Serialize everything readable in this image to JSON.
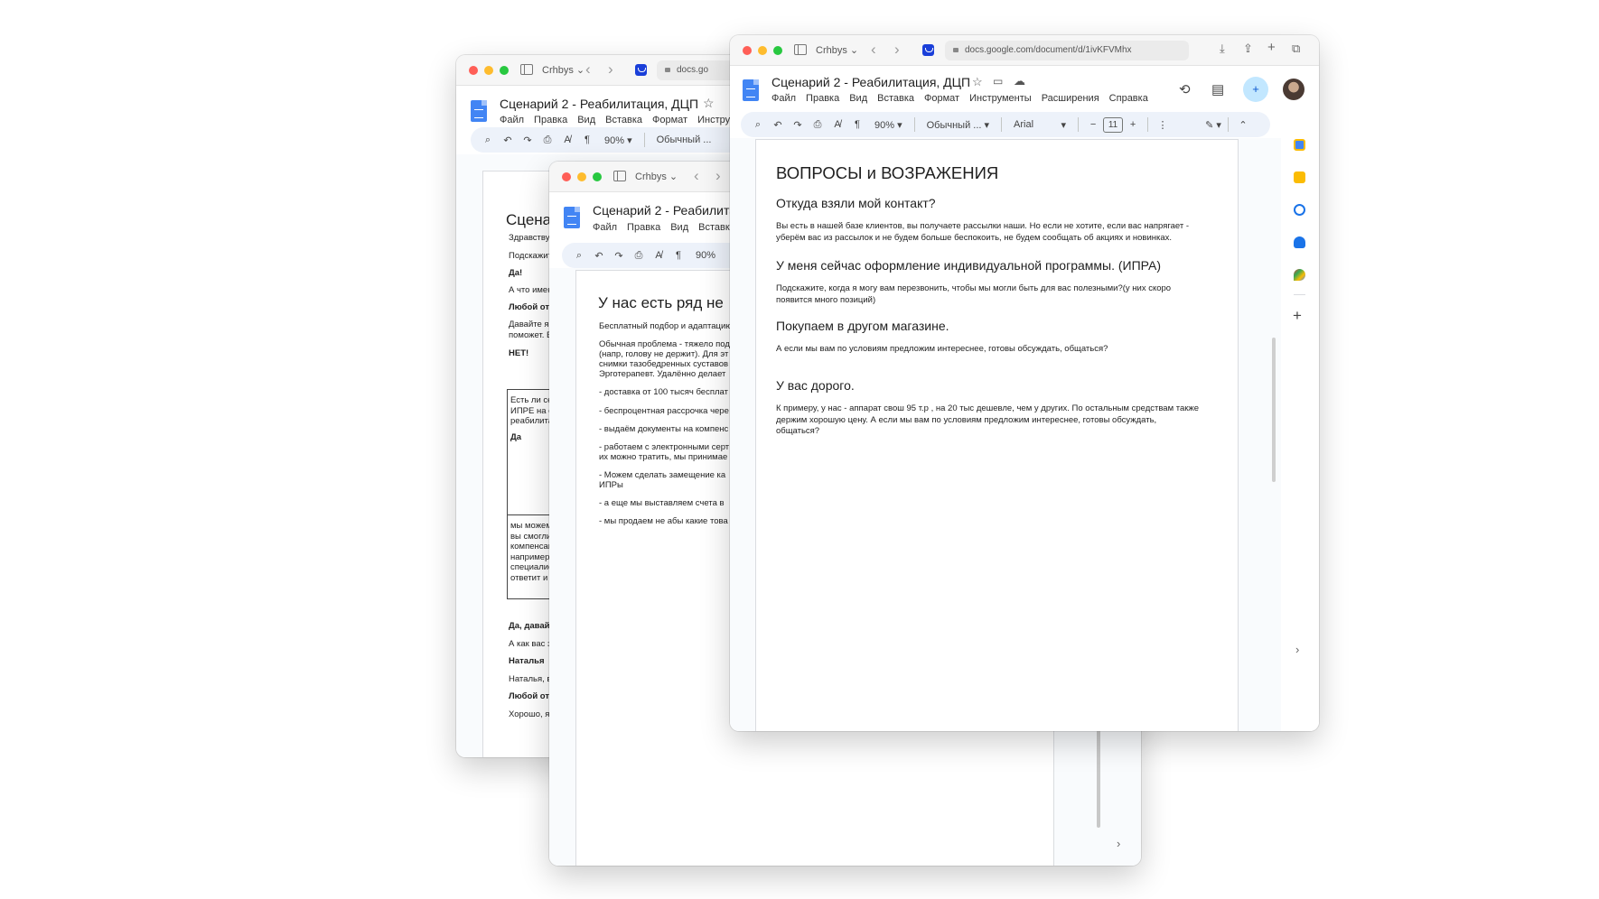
{
  "windowA": {
    "browser": {
      "profile": "Crhbys",
      "url": "docs.go"
    },
    "doc": {
      "title": "Сценарий 2 - Реабилитация, ДЦП",
      "menu": [
        "Файл",
        "Правка",
        "Вид",
        "Вставка",
        "Формат",
        "Инстру"
      ],
      "toolbar": {
        "zoom": "90%",
        "style": "Обычный ..."
      }
    },
    "page": {
      "heading": "Сцена",
      "lines": [
        {
          "text": "Здравствуй",
          "bold": false
        },
        {
          "text": "Подскажите",
          "bold": false
        },
        {
          "text": "Да!",
          "bold": true
        },
        {
          "text": "А что имен",
          "bold": false
        },
        {
          "text": "Любой отв",
          "bold": true
        },
        {
          "text": "Давайте я",
          "bold": false
        },
        {
          "text": "поможет. В",
          "bold": false
        },
        {
          "text": "НЕТ!",
          "bold": true
        }
      ],
      "table_lines": [
        "Есть ли се",
        "ИПРЕ на с",
        "реабилита"
      ],
      "table_bold": "Да",
      "table_lines2": [
        "мы можем",
        "вы смогли",
        "компенсац",
        "например",
        "специалис",
        "ответит и"
      ],
      "after_lines": [
        {
          "text": "Да, давайт",
          "bold": true
        },
        {
          "text": "А как вас з",
          "bold": false
        },
        {
          "text": "Наталья",
          "bold": true
        },
        {
          "text": "Наталья, в",
          "bold": false
        },
        {
          "text": "Любой отв",
          "bold": true
        },
        {
          "text": "Хорошо, я",
          "bold": false
        }
      ]
    }
  },
  "windowB": {
    "browser": {
      "profile": "Crhbys"
    },
    "doc": {
      "title": "Сценарий 2 - Реабилитац",
      "menu": [
        "Файл",
        "Правка",
        "Вид",
        "Вставка"
      ],
      "toolbar": {
        "zoom": "90%"
      }
    },
    "page": {
      "heading": "У нас есть ряд не",
      "lines": [
        "Бесплатный подбор и адаптацию",
        "Обычная проблема - тяжело под",
        "(напр, голову не держит). Для эт",
        "снимки тазобедренных суставов",
        "Эрготерапевт. Удалённо делает",
        "- доставка от 100 тысяч бесплат",
        "- беспроцентная рассрочка чере",
        "- выдаём документы на компенс",
        "- работаем с электронными серт",
        "их можно тратить, мы принимае",
        "- Можем сделать замещение ка",
        "ИПРы",
        "- а еще мы выставляем счета в",
        "- мы продаем не абы какие това"
      ]
    }
  },
  "windowC": {
    "browser": {
      "profile": "Crhbys",
      "url": "docs.google.com/document/d/1ivKFVMhx"
    },
    "doc": {
      "title": "Сценарий 2 - Реабилитация, ДЦП",
      "menu": [
        "Файл",
        "Правка",
        "Вид",
        "Вставка",
        "Формат",
        "Инструменты",
        "Расширения",
        "Справка"
      ],
      "toolbar": {
        "zoom": "90%",
        "style": "Обычный ...",
        "font": "Arial",
        "font_size": "11"
      }
    },
    "page": {
      "title": "ВОПРОСЫ и ВОЗРАЖЕНИЯ",
      "sections": [
        {
          "heading": "Откуда взяли мой контакт?",
          "text": "Вы есть в нашей базе клиентов, вы получаете рассылки наши. Но если не хотите, если вас напрягает - уберём вас из рассылок и не будем больше беспокоить, не будем сообщать об акциях и новинках."
        },
        {
          "heading": "У меня сейчас оформление индивидуальной программы. (ИПРА)",
          "text": "Подскажите, когда я могу вам перезвонить, чтобы мы могли быть для вас полезными?(у них скоро появится много позиций)"
        },
        {
          "heading": "Покупаем в другом магазине.",
          "text": "А если мы вам по условиям предложим интереснее, готовы обсуждать, общаться?"
        },
        {
          "heading": "У вас дорого.",
          "text": "К примеру, у нас - аппарат свош 95 т.р , на 20 тыс дешевле, чем у других. По остальным средствам также держим хорошую цену. А если мы вам по условиям предложим интереснее, готовы обсуждать, общаться?"
        }
      ]
    }
  }
}
